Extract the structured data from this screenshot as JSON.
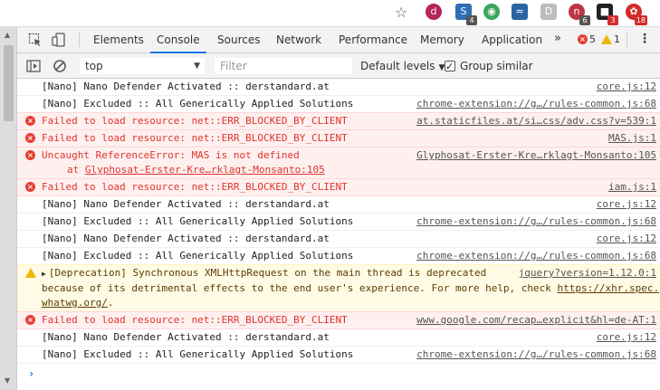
{
  "extension_bar": {
    "icons": [
      {
        "name": "star-icon",
        "glyph": "☆"
      },
      {
        "name": "nano-defender-icon",
        "glyph": "d",
        "color": "#b5245b",
        "badge": ""
      },
      {
        "name": "extension-s-icon",
        "glyph": "S",
        "color": "#2f6db5",
        "badge": "4"
      },
      {
        "name": "extension-green-icon",
        "glyph": "◉",
        "color": "#3aa55d",
        "badge": ""
      },
      {
        "name": "extension-wave-icon",
        "glyph": "≈",
        "color": "#2864a3",
        "badge": ""
      },
      {
        "name": "extension-d-icon",
        "glyph": "D",
        "color": "#bcbcbc",
        "badge": ""
      },
      {
        "name": "extension-n-icon",
        "glyph": "n",
        "color": "#c03548",
        "badge": "6"
      },
      {
        "name": "extension-black-icon",
        "glyph": "■",
        "color": "#222222",
        "badge": "3"
      },
      {
        "name": "extension-red-icon",
        "glyph": "✿",
        "color": "#d42b2b",
        "badge": "18"
      }
    ]
  },
  "devtools": {
    "tabs": [
      "Elements",
      "Console",
      "Sources",
      "Network",
      "Performance",
      "Memory",
      "Application"
    ],
    "active_tab": "Console",
    "more": "»",
    "error_count": "5",
    "warning_count": "1",
    "menu": "⋮"
  },
  "console_toolbar": {
    "context": "top",
    "filter_placeholder": "Filter",
    "levels": "Default levels",
    "group_similar": "Group similar",
    "group_similar_checked": true
  },
  "messages": [
    {
      "level": "log",
      "text": "[Nano] Nano Defender Activated :: derstandard.at",
      "source": "core.js:12"
    },
    {
      "level": "log",
      "text": "[Nano] Excluded :: All Generically Applied Solutions",
      "source": "chrome-extension://g…/rules-common.js:68"
    },
    {
      "level": "error",
      "text": "Failed to load resource: net::ERR_BLOCKED_BY_CLIENT",
      "source": "at.staticfiles.at/si…css/adv.css?v=539:1"
    },
    {
      "level": "error",
      "text": "Failed to load resource: net::ERR_BLOCKED_BY_CLIENT",
      "source": "MAS.js:1"
    },
    {
      "level": "error",
      "text": "Uncaught ReferenceError: MAS is not defined",
      "trace_prefix": "at ",
      "trace_link": "Glyphosat-Erster-Kre…rklagt-Monsanto:105",
      "source": "Glyphosat-Erster-Kre…rklagt-Monsanto:105"
    },
    {
      "level": "error",
      "text": "Failed to load resource: net::ERR_BLOCKED_BY_CLIENT",
      "source": "iam.js:1"
    },
    {
      "level": "log",
      "text": "[Nano] Nano Defender Activated :: derstandard.at",
      "source": "core.js:12"
    },
    {
      "level": "log",
      "text": "[Nano] Excluded :: All Generically Applied Solutions",
      "source": "chrome-extension://g…/rules-common.js:68"
    },
    {
      "level": "log",
      "text": "[Nano] Nano Defender Activated :: derstandard.at",
      "source": "core.js:12"
    },
    {
      "level": "log",
      "text": "[Nano] Excluded :: All Generically Applied Solutions",
      "source": "chrome-extension://g…/rules-common.js:68"
    },
    {
      "level": "warning",
      "line1": "[Deprecation] Synchronous XMLHttpRequest on the main thread is deprecated",
      "line2_prefix": "because of its detrimental effects to the end user's experience. For more help, check ",
      "line2_link": "https://xhr.spec.",
      "line3_link": "whatwg.org/",
      "line3_suffix": ".",
      "source": "jquery?version=1.12.0:1"
    },
    {
      "level": "error",
      "text": "Failed to load resource: net::ERR_BLOCKED_BY_CLIENT",
      "source": "www.google.com/recap…explicit&hl=de-AT:1"
    },
    {
      "level": "log",
      "text": "[Nano] Nano Defender Activated :: derstandard.at",
      "source": "core.js:12"
    },
    {
      "level": "log",
      "text": "[Nano] Excluded :: All Generically Applied Solutions",
      "source": "chrome-extension://g…/rules-common.js:68"
    }
  ],
  "prompt_symbol": "›"
}
